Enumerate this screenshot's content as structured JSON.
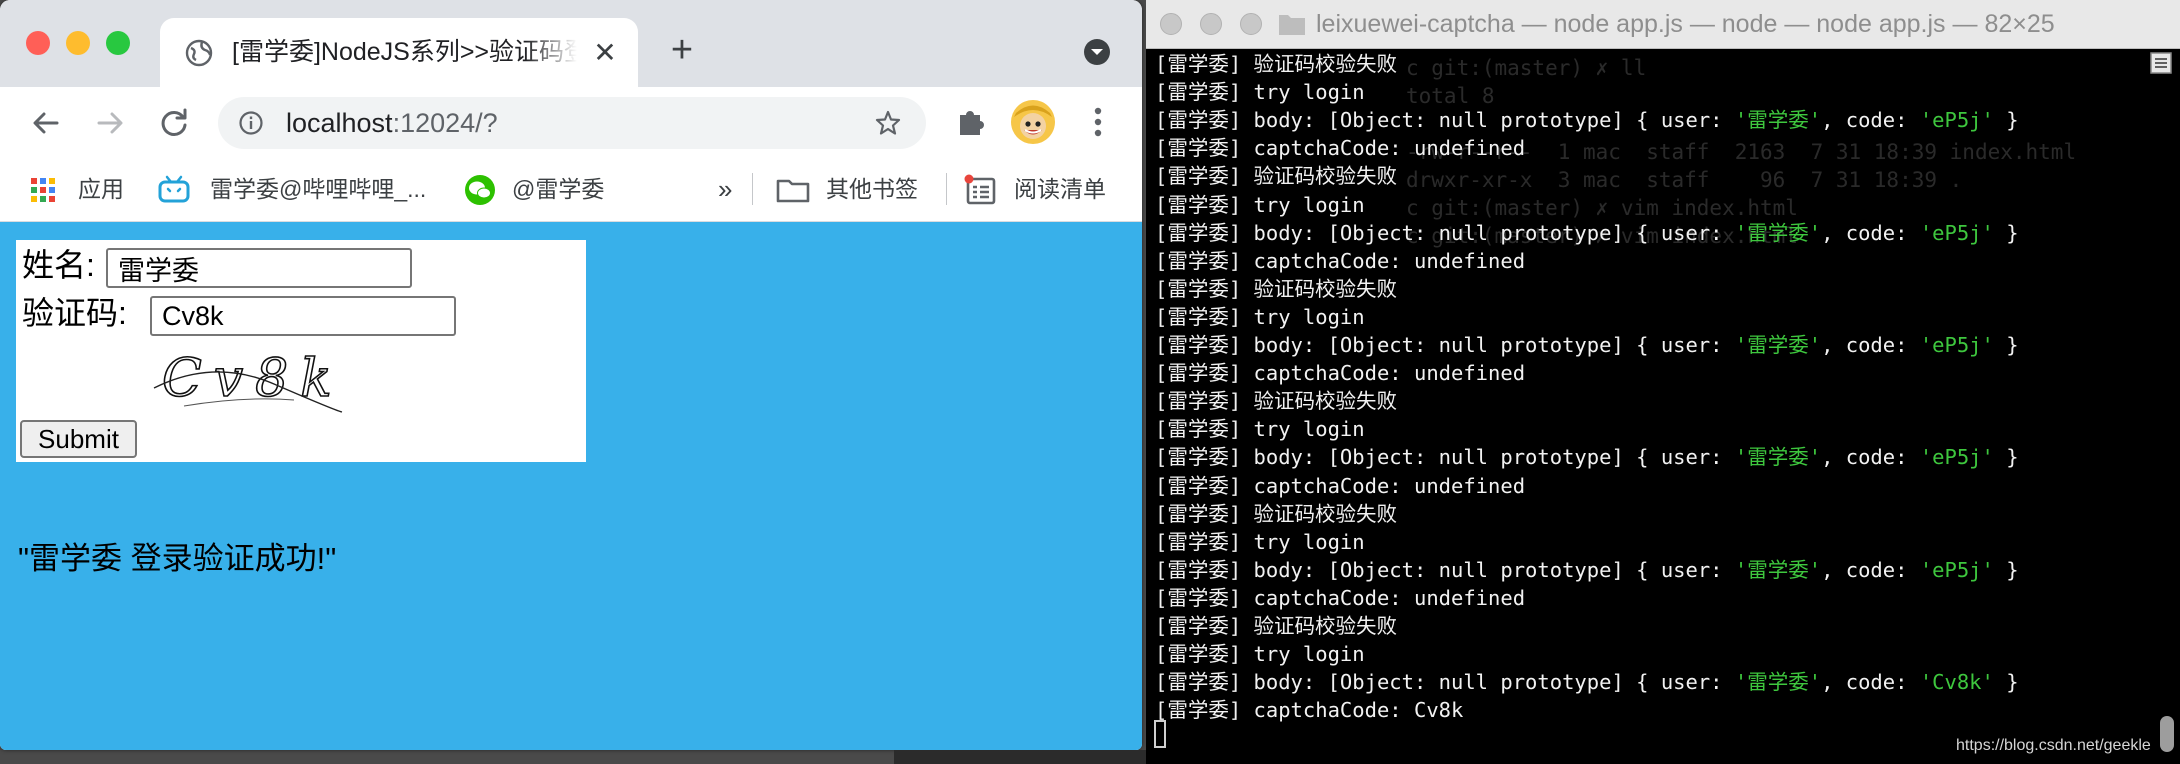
{
  "browser": {
    "tab_title": "[雷学委]NodeJS系列>>验证码登录",
    "address_host": "localhost",
    "address_rest": ":12024/?",
    "bookmarks": {
      "apps": "应用",
      "bilibili": "雷学委@哔哩哔哩_...",
      "wechat": "@雷学委",
      "overflow": "»",
      "other": "其他书签",
      "reading_list": "阅读清单"
    },
    "page": {
      "name_label": "姓名:",
      "name_value": "雷学委",
      "captcha_label": "验证码:",
      "captcha_value": "Cv8k",
      "captcha_image_text": "Cv8k",
      "submit_label": "Submit",
      "result_text": "\"雷学委 登录验证成功!\""
    }
  },
  "terminal": {
    "title": "leixuewei-captcha — node app.js — node — node app.js — 82×25",
    "lines": [
      [
        {
          "t": "[雷学委] 验证码校验失败"
        }
      ],
      [
        {
          "t": "[雷学委] try login"
        }
      ],
      [
        {
          "t": "[雷学委] body: [Object: null prototype] { user: "
        },
        {
          "t": "'雷学委'",
          "g": 1
        },
        {
          "t": ", code: "
        },
        {
          "t": "'eP5j'",
          "g": 1
        },
        {
          "t": " }"
        }
      ],
      [
        {
          "t": "[雷学委] captchaCode: undefined"
        }
      ],
      [
        {
          "t": "[雷学委] 验证码校验失败"
        }
      ],
      [
        {
          "t": "[雷学委] try login"
        }
      ],
      [
        {
          "t": "[雷学委] body: [Object: null prototype] { user: "
        },
        {
          "t": "'雷学委'",
          "g": 1
        },
        {
          "t": ", code: "
        },
        {
          "t": "'eP5j'",
          "g": 1
        },
        {
          "t": " }"
        }
      ],
      [
        {
          "t": "[雷学委] captchaCode: undefined"
        }
      ],
      [
        {
          "t": "[雷学委] 验证码校验失败"
        }
      ],
      [
        {
          "t": "[雷学委] try login"
        }
      ],
      [
        {
          "t": "[雷学委] body: [Object: null prototype] { user: "
        },
        {
          "t": "'雷学委'",
          "g": 1
        },
        {
          "t": ", code: "
        },
        {
          "t": "'eP5j'",
          "g": 1
        },
        {
          "t": " }"
        }
      ],
      [
        {
          "t": "[雷学委] captchaCode: undefined"
        }
      ],
      [
        {
          "t": "[雷学委] 验证码校验失败"
        }
      ],
      [
        {
          "t": "[雷学委] try login"
        }
      ],
      [
        {
          "t": "[雷学委] body: [Object: null prototype] { user: "
        },
        {
          "t": "'雷学委'",
          "g": 1
        },
        {
          "t": ", code: "
        },
        {
          "t": "'eP5j'",
          "g": 1
        },
        {
          "t": " }"
        }
      ],
      [
        {
          "t": "[雷学委] captchaCode: undefined"
        }
      ],
      [
        {
          "t": "[雷学委] 验证码校验失败"
        }
      ],
      [
        {
          "t": "[雷学委] try login"
        }
      ],
      [
        {
          "t": "[雷学委] body: [Object: null prototype] { user: "
        },
        {
          "t": "'雷学委'",
          "g": 1
        },
        {
          "t": ", code: "
        },
        {
          "t": "'eP5j'",
          "g": 1
        },
        {
          "t": " }"
        }
      ],
      [
        {
          "t": "[雷学委] captchaCode: undefined"
        }
      ],
      [
        {
          "t": "[雷学委] 验证码校验失败"
        }
      ],
      [
        {
          "t": "[雷学委] try login"
        }
      ],
      [
        {
          "t": "[雷学委] body: [Object: null prototype] { user: "
        },
        {
          "t": "'雷学委'",
          "g": 1
        },
        {
          "t": ", code: "
        },
        {
          "t": "'Cv8k'",
          "g": 1
        },
        {
          "t": " }"
        }
      ],
      [
        {
          "t": "[雷学委] captchaCode: Cv8k"
        }
      ]
    ],
    "background_lines": [
      "c git:(master) ✗ ll",
      "total 8",
      "-rw-r--r--  1 mac  staff  2163  7 31 18:39 index.html",
      "drwxr-xr-x  3 mac  staff    96  7 31 18:39 .",
      "c git:(master) ✗ vim index.html",
      "c git:(master) ✗ vim index.html"
    ],
    "watermark": "https://blog.csdn.net/geekle"
  },
  "colors": {
    "page_background": "#38b0ea",
    "terminal_green": "#3ec73e",
    "close": "#ff5f57",
    "minimize": "#febc2e",
    "zoom": "#28c840"
  }
}
